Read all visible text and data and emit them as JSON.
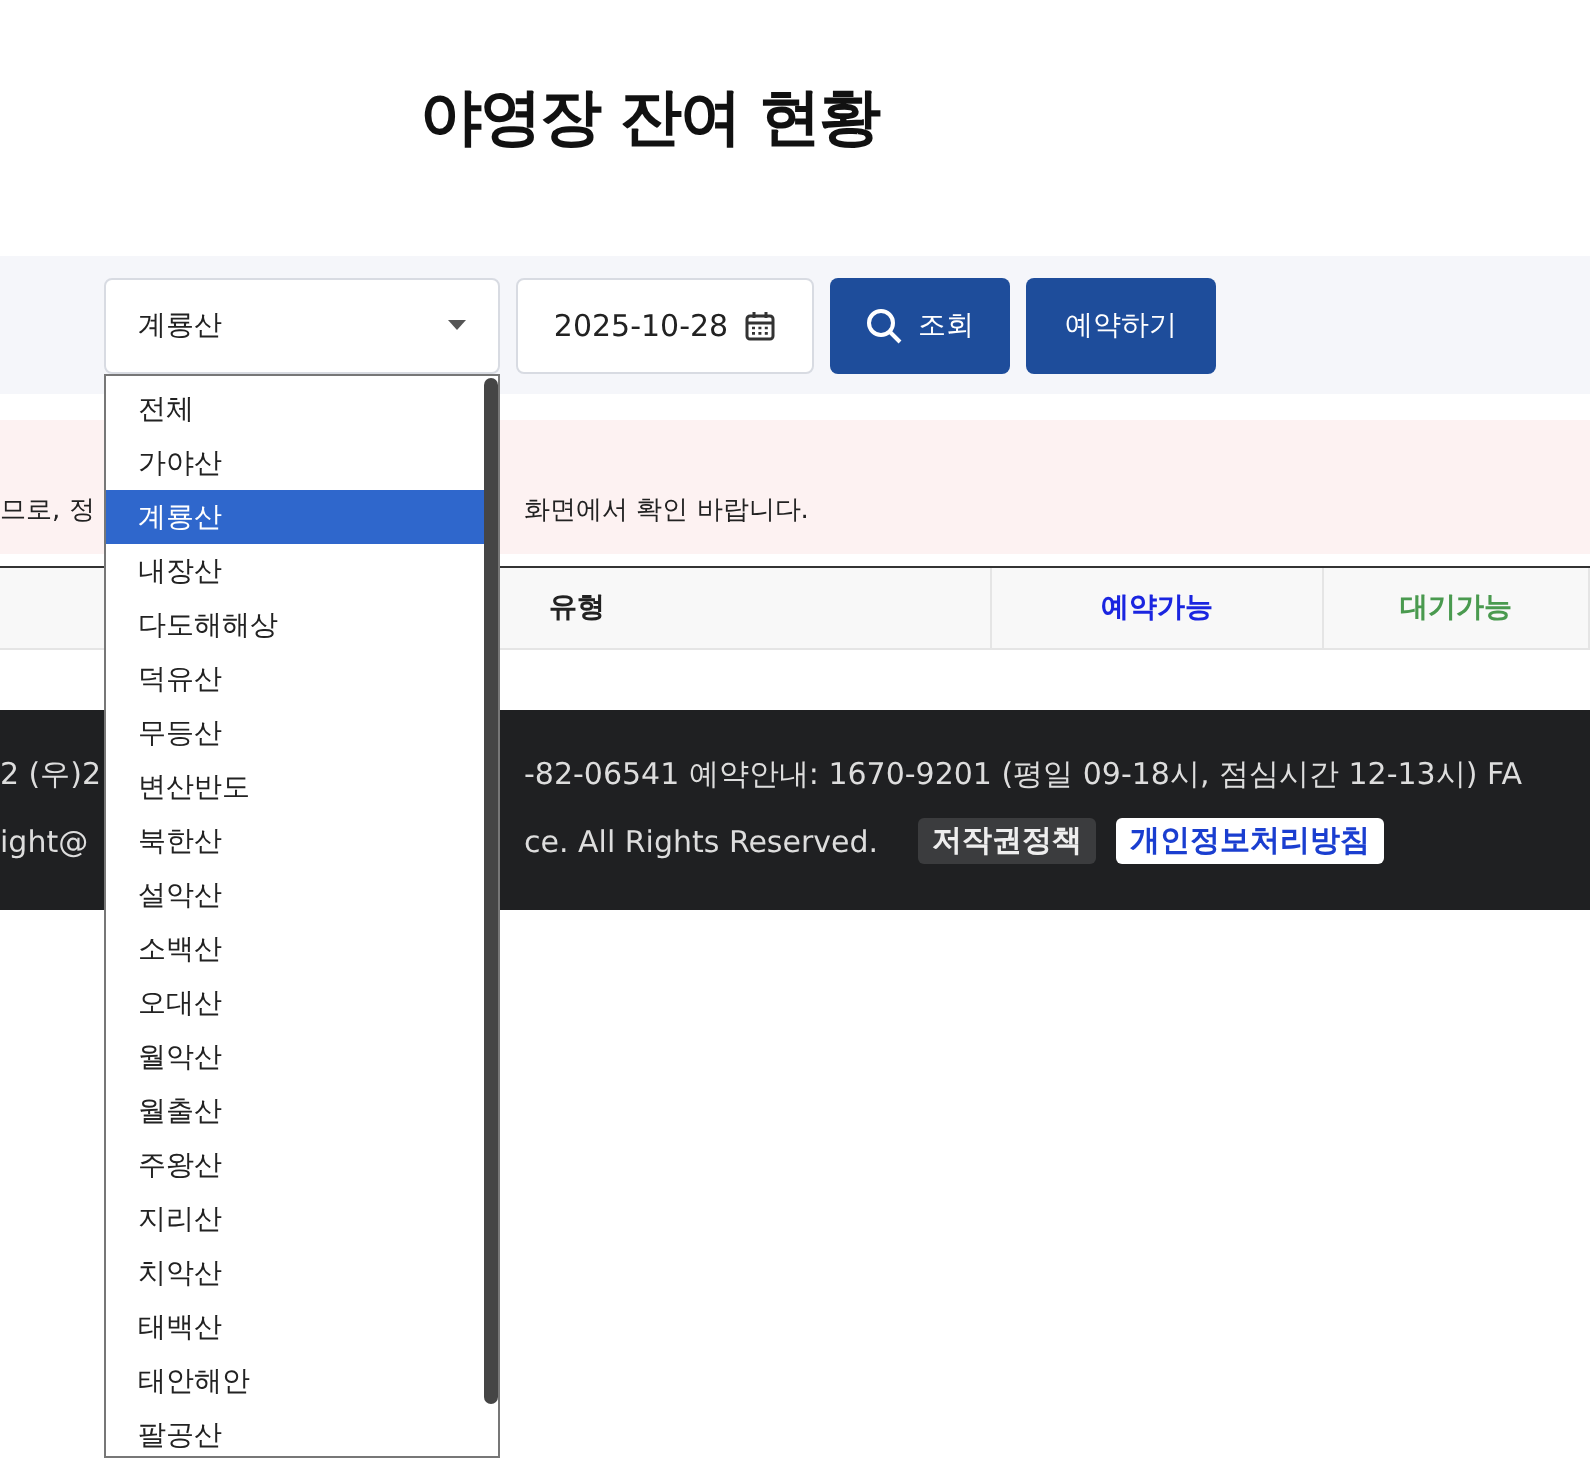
{
  "title": "야영장 잔여 현황",
  "search": {
    "site": "계룡산",
    "date": "2025-10-28",
    "search_button": "조회",
    "reserve_button": "예약하기"
  },
  "notice": {
    "left": "므로, 정",
    "right": "화면에서 확인 바랍니다."
  },
  "table": {
    "columns": [
      {
        "label": "유형",
        "color": "#222222"
      },
      {
        "label": "예약가능",
        "color": "#1a25e0"
      },
      {
        "label": "대기가능",
        "color": "#4a9a4f"
      }
    ]
  },
  "footer": {
    "line_1_left": "2 (우)2",
    "line_1_right": "-82-06541   예약안내: 1670-9201 (평일 09-18시, 점심시간 12-13시)   FA",
    "line_2_left": "ight@",
    "line_2_right": "ce. All Rights Reserved.",
    "links": [
      {
        "label": "저작권정책",
        "highlight": false
      },
      {
        "label": "개인정보처리방침",
        "highlight": true
      }
    ]
  },
  "dropdown": {
    "options": [
      {
        "label": "전체",
        "selected": false
      },
      {
        "label": "가야산",
        "selected": false
      },
      {
        "label": "계룡산",
        "selected": true
      },
      {
        "label": "내장산",
        "selected": false
      },
      {
        "label": "다도해해상",
        "selected": false
      },
      {
        "label": "덕유산",
        "selected": false
      },
      {
        "label": "무등산",
        "selected": false
      },
      {
        "label": "변산반도",
        "selected": false
      },
      {
        "label": "북한산",
        "selected": false
      },
      {
        "label": "설악산",
        "selected": false
      },
      {
        "label": "소백산",
        "selected": false
      },
      {
        "label": "오대산",
        "selected": false
      },
      {
        "label": "월악산",
        "selected": false
      },
      {
        "label": "월출산",
        "selected": false
      },
      {
        "label": "주왕산",
        "selected": false
      },
      {
        "label": "지리산",
        "selected": false
      },
      {
        "label": "치악산",
        "selected": false
      },
      {
        "label": "태백산",
        "selected": false
      },
      {
        "label": "태안해안",
        "selected": false
      },
      {
        "label": "팔공산",
        "selected": false
      }
    ]
  }
}
